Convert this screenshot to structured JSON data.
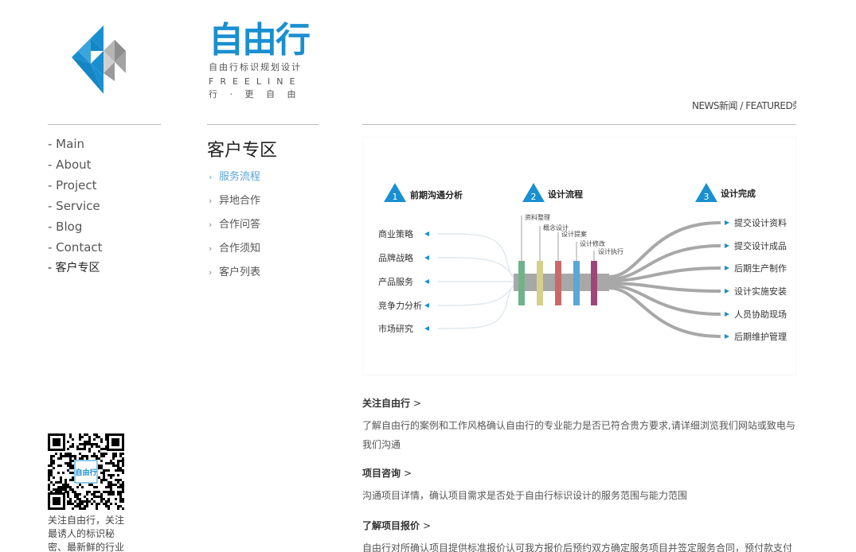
{
  "brand": {
    "name": "自由行",
    "tagline": "自由行标识规划设计",
    "english": "FREELINE",
    "slogan": "行 · 更 自 由",
    "primary_color": "#1a8fd0",
    "secondary_color": "#9a9a9a"
  },
  "topnav": {
    "item1": "NEWS新闻",
    "separator": " / ",
    "item2": "FEATURED荣誉"
  },
  "mainnav": {
    "items": [
      "- Main",
      "- About",
      "- Project",
      "- Service",
      "- Blog",
      "- Contact",
      "- 客户专区"
    ],
    "active_index": 6
  },
  "section": {
    "title": "客户专区",
    "subnav": [
      "服务流程",
      "异地合作",
      "合作问答",
      "合作须知",
      "客户列表"
    ],
    "active_index": 0,
    "active_color": "#5ba6d6"
  },
  "diagram": {
    "stages": [
      {
        "num": "1",
        "label": "前期沟通分析"
      },
      {
        "num": "2",
        "label": "设计流程"
      },
      {
        "num": "3",
        "label": "设计完成"
      }
    ],
    "inputs": [
      "商业策略",
      "品牌战略",
      "产品服务",
      "竞争力分析",
      "市场研究"
    ],
    "process": [
      {
        "label": "资料整理",
        "color": "#6fb38a"
      },
      {
        "label": "概念设计",
        "color": "#d6d08a"
      },
      {
        "label": "设计提案",
        "color": "#c96a6a"
      },
      {
        "label": "设计修改",
        "color": "#5aa8d6"
      },
      {
        "label": "设计执行",
        "color": "#a0457a"
      }
    ],
    "outputs": [
      "提交设计资料",
      "提交设计成品",
      "后期生产制作",
      "设计实施安装",
      "人员协助现场",
      "后期维护管理"
    ],
    "accent_color": "#1a8fd0",
    "bar_color": "#a8a8a8"
  },
  "articles": [
    {
      "title": "关注自由行",
      "arrow": ">",
      "body": "了解自由行的案例和工作风格确认自由行的专业能力是否已符合贵方要求,请详细浏览我们网站或致电与我们沟通"
    },
    {
      "title": "项目咨询",
      "arrow": ">",
      "body": "沟通项目详情，确认项目需求是否处于自由行标识设计的服务范围与能力范围"
    },
    {
      "title": "了解项目报价",
      "arrow": ">",
      "body": "自由行对所确认项目提供标准报价认可我方报价后预约双方确定服务项目并签定服务合同，预付款支付"
    }
  ],
  "sidebar": {
    "qr_label": "自由行",
    "qr_caption": "关注自由行，关注最诱人的标识秘密、最新鲜的行业"
  }
}
